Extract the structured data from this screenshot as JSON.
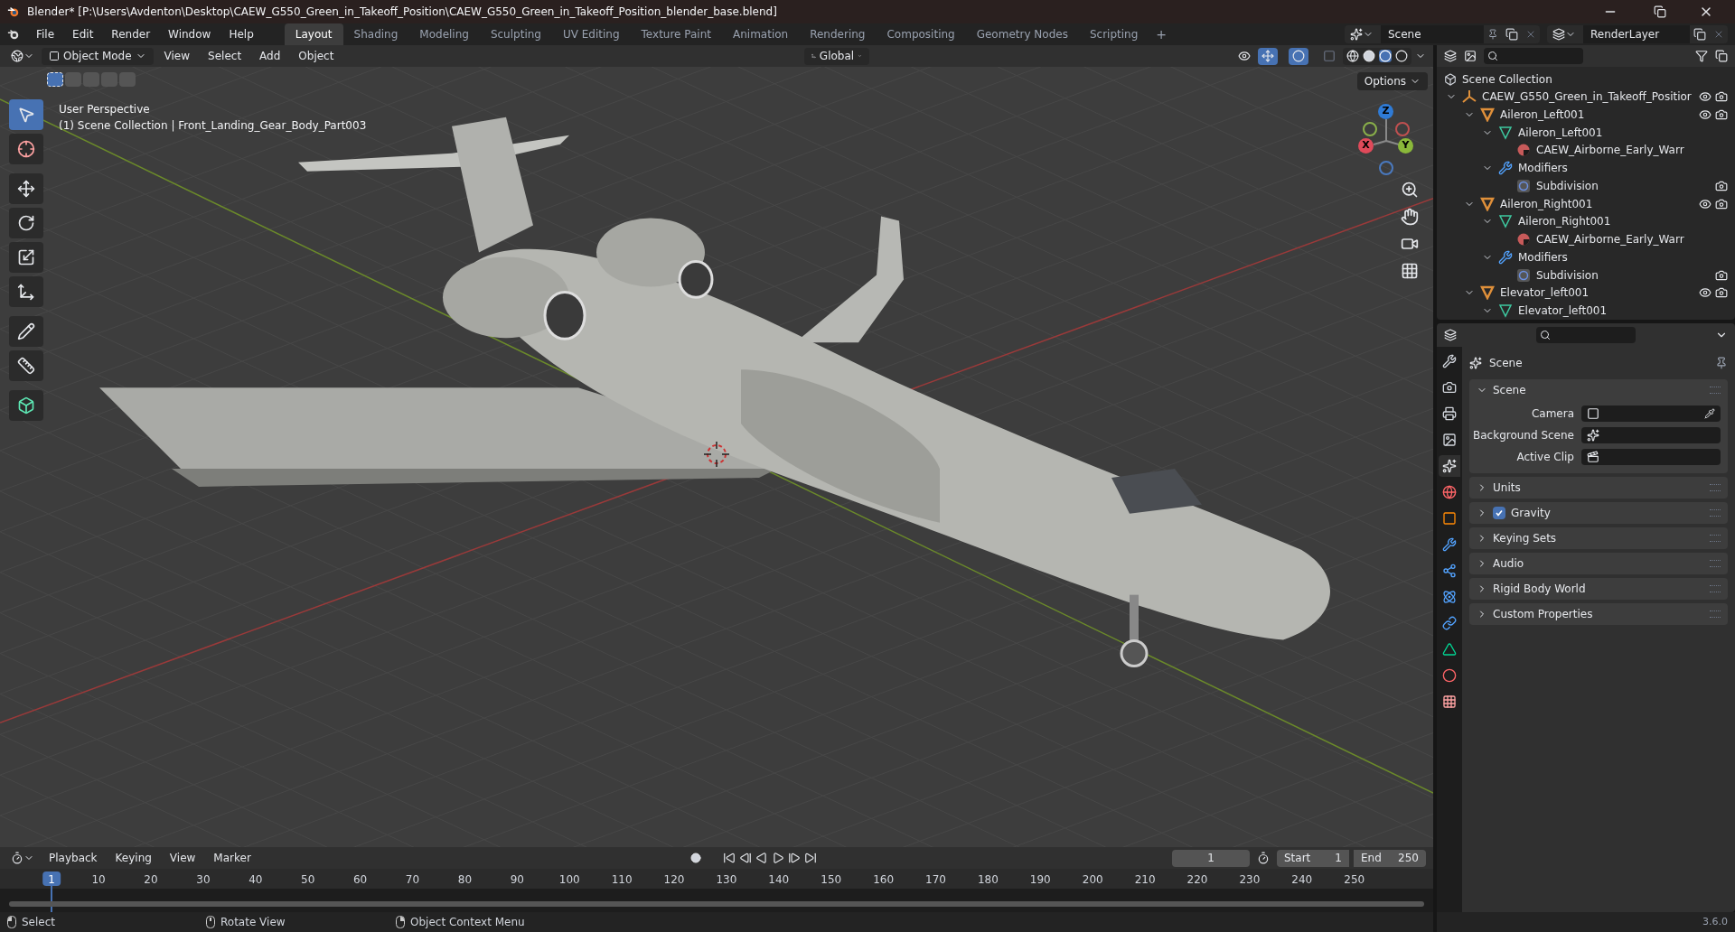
{
  "title_bar": {
    "title": "Blender* [P:\\Users\\Avdenton\\Desktop\\CAEW_G550_Green_in_Takeoff_Position\\CAEW_G550_Green_in_Takeoff_Position_blender_base.blend]"
  },
  "menu": [
    "File",
    "Edit",
    "Render",
    "Window",
    "Help"
  ],
  "workspaces": [
    {
      "label": "Layout",
      "selected": true
    },
    {
      "label": "Shading",
      "selected": false
    },
    {
      "label": "Modeling",
      "selected": false
    },
    {
      "label": "Sculpting",
      "selected": false
    },
    {
      "label": "UV Editing",
      "selected": false
    },
    {
      "label": "Texture Paint",
      "selected": false
    },
    {
      "label": "Animation",
      "selected": false
    },
    {
      "label": "Rendering",
      "selected": false
    },
    {
      "label": "Compositing",
      "selected": false
    },
    {
      "label": "Geometry Nodes",
      "selected": false
    },
    {
      "label": "Scripting",
      "selected": false
    }
  ],
  "add_workspace": "+",
  "scene_selector": {
    "value": "Scene"
  },
  "view_layer_selector": {
    "value": "RenderLayer"
  },
  "viewport_header": {
    "mode": "Object Mode",
    "menus": [
      "View",
      "Select",
      "Add",
      "Object"
    ],
    "orientation": "Global",
    "options": "Options"
  },
  "viewport": {
    "view_name": "User Perspective",
    "context": "(1) Scene Collection | Front_Landing_Gear_Body_Part003"
  },
  "tools": [
    {
      "kind": "select",
      "selected": true
    },
    {
      "kind": "cursor",
      "selected": false
    },
    {
      "kind": "move",
      "selected": false
    },
    {
      "kind": "rotate",
      "selected": false
    },
    {
      "kind": "scale",
      "selected": false
    },
    {
      "kind": "transform",
      "selected": false
    },
    {
      "kind": "annotate",
      "selected": false
    },
    {
      "kind": "measure",
      "selected": false
    },
    {
      "kind": "add_cube",
      "selected": false
    }
  ],
  "gizmo": {
    "x": "X",
    "y": "Y",
    "z": "Z"
  },
  "outliner": {
    "root": "Scene Collection",
    "items": [
      {
        "kind": "empty",
        "label": "CAEW_G550_Green_in_Takeoff_Positior",
        "expanded": true,
        "children": [
          {
            "kind": "object",
            "label": "Aileron_Left001",
            "expanded": true,
            "children": [
              {
                "kind": "mesh",
                "label": "Aileron_Left001",
                "expanded": true,
                "children": [
                  {
                    "kind": "material",
                    "label": "CAEW_Airborne_Early_Warr"
                  }
                ]
              },
              {
                "kind": "modifiers",
                "label": "Modifiers",
                "expanded": true,
                "children": [
                  {
                    "kind": "modifier",
                    "label": "Subdivision"
                  }
                ]
              }
            ]
          },
          {
            "kind": "object",
            "label": "Aileron_Right001",
            "expanded": true,
            "children": [
              {
                "kind": "mesh",
                "label": "Aileron_Right001",
                "expanded": true,
                "children": [
                  {
                    "kind": "material",
                    "label": "CAEW_Airborne_Early_Warr"
                  }
                ]
              },
              {
                "kind": "modifiers",
                "label": "Modifiers",
                "expanded": true,
                "children": [
                  {
                    "kind": "modifier",
                    "label": "Subdivision"
                  }
                ]
              }
            ]
          },
          {
            "kind": "object",
            "label": "Elevator_left001",
            "expanded": true,
            "children": [
              {
                "kind": "mesh",
                "label": "Elevator_left001",
                "expanded": true
              }
            ]
          }
        ]
      }
    ]
  },
  "properties": {
    "tabs": [
      {
        "kind": "tool",
        "selected": false
      },
      {
        "kind": "render",
        "selected": false
      },
      {
        "kind": "output",
        "selected": false
      },
      {
        "kind": "view_layer",
        "selected": false
      },
      {
        "kind": "scene",
        "selected": true
      },
      {
        "kind": "world",
        "selected": false
      },
      {
        "kind": "object",
        "selected": false
      },
      {
        "kind": "modifiers",
        "selected": false
      },
      {
        "kind": "particles",
        "selected": false
      },
      {
        "kind": "physics",
        "selected": false
      },
      {
        "kind": "constraints",
        "selected": false
      },
      {
        "kind": "data",
        "selected": false
      },
      {
        "kind": "material",
        "selected": false
      },
      {
        "kind": "texture",
        "selected": false
      }
    ],
    "context": "Scene",
    "panels": [
      {
        "kind": "panel",
        "title": "Scene",
        "expanded": true,
        "fields": [
          {
            "kind": "camera",
            "label": "Camera"
          },
          {
            "kind": "scene",
            "label": "Background Scene"
          },
          {
            "kind": "clip",
            "label": "Active Clip"
          }
        ]
      },
      {
        "kind": "panel",
        "title": "Units",
        "expanded": false
      },
      {
        "kind": "checkbox_panel",
        "title": "Gravity",
        "expanded": false,
        "checked": true
      },
      {
        "kind": "panel",
        "title": "Keying Sets",
        "expanded": false
      },
      {
        "kind": "panel",
        "title": "Audio",
        "expanded": false
      },
      {
        "kind": "panel",
        "title": "Rigid Body World",
        "expanded": false
      },
      {
        "kind": "panel",
        "title": "Custom Properties",
        "expanded": false
      }
    ]
  },
  "timeline": {
    "menus": [
      "Playback",
      "Keying",
      "View",
      "Marker"
    ],
    "current_frame": "1",
    "start_label": "Start",
    "start": "1",
    "end_label": "End",
    "end": "250",
    "ruler": [
      "1",
      "10",
      "20",
      "30",
      "40",
      "50",
      "60",
      "70",
      "80",
      "90",
      "100",
      "110",
      "120",
      "130",
      "140",
      "150",
      "160",
      "170",
      "180",
      "190",
      "200",
      "210",
      "220",
      "230",
      "240",
      "250"
    ]
  },
  "status_bar": {
    "items": [
      {
        "kind": "left_mouse",
        "label": "Select"
      },
      {
        "kind": "middle_mouse",
        "label": "Rotate View"
      },
      {
        "kind": "right_mouse",
        "label": "Object Context Menu"
      }
    ],
    "version": "3.6.0"
  }
}
